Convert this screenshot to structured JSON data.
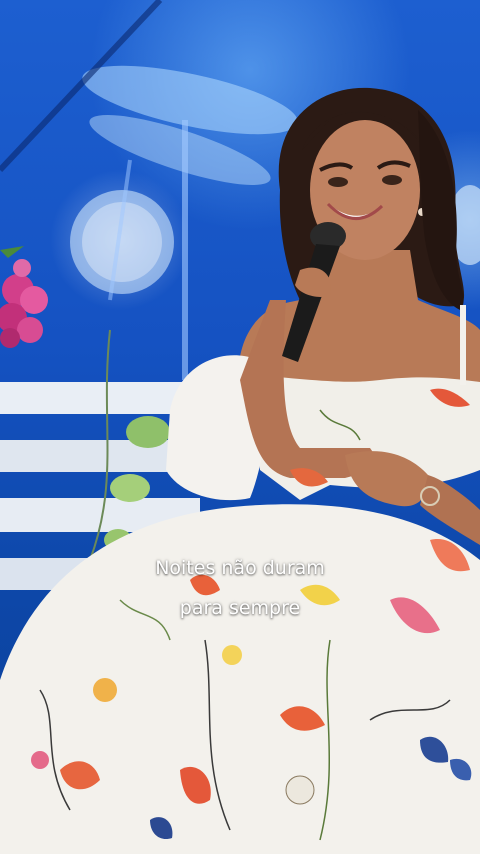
{
  "caption": {
    "line1": "Noites não duram",
    "line2": "para sempre"
  },
  "colors": {
    "stage_blue": "#1552c2",
    "dress_white": "#f3f1ec",
    "hair": "#2b1a14",
    "skin": "#b87a57"
  }
}
